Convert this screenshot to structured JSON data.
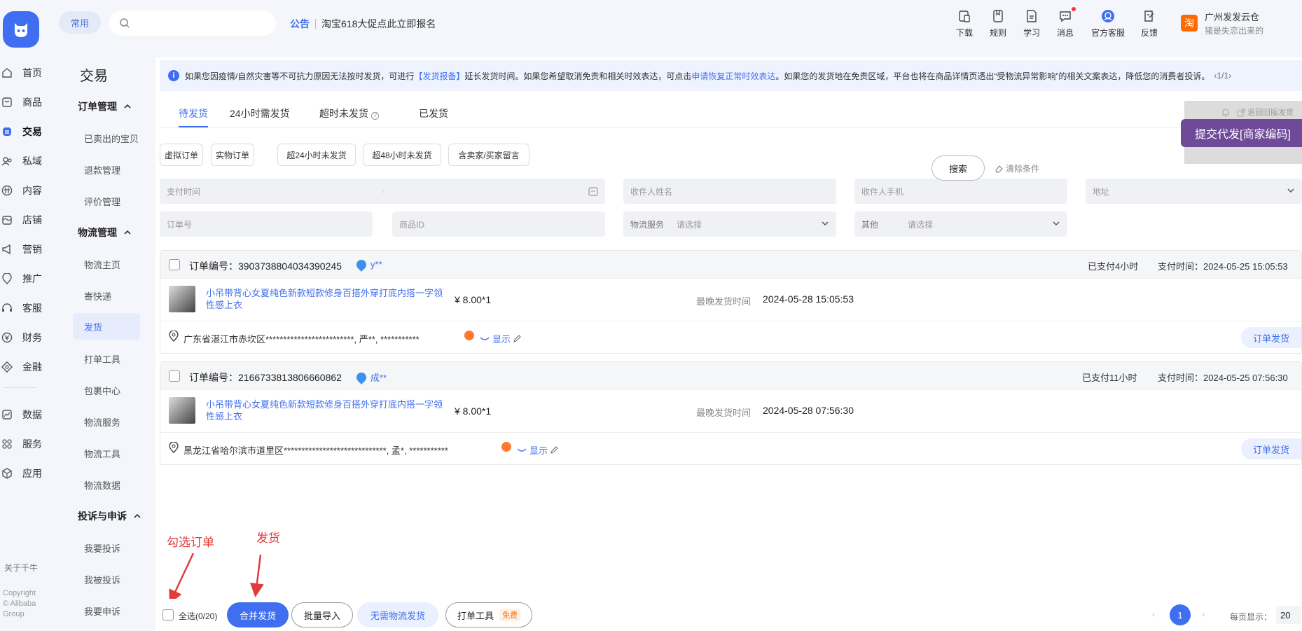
{
  "header": {
    "common_label": "常用",
    "search_placeholder": "",
    "notice_tag": "公告",
    "notice_text": "淘宝618大促点此立即报名",
    "tools": [
      {
        "label": "下载",
        "icon": "download-icon"
      },
      {
        "label": "规则",
        "icon": "rules-icon"
      },
      {
        "label": "学习",
        "icon": "study-icon"
      },
      {
        "label": "消息",
        "icon": "message-icon"
      },
      {
        "label": "官方客服",
        "icon": "service-icon"
      },
      {
        "label": "反馈",
        "icon": "feedback-icon"
      }
    ],
    "shop_badge": "淘",
    "shop_name": "广州发发云仓",
    "shop_sub": "猪是失恋出来的"
  },
  "rail": {
    "items": [
      {
        "label": "首页",
        "icon": "home-icon"
      },
      {
        "label": "商品",
        "icon": "goods-icon"
      },
      {
        "label": "交易",
        "icon": "trade-icon",
        "active": true
      },
      {
        "label": "私域",
        "icon": "private-icon"
      },
      {
        "label": "内容",
        "icon": "content-icon"
      },
      {
        "label": "店铺",
        "icon": "shop-icon"
      },
      {
        "label": "营销",
        "icon": "marketing-icon"
      },
      {
        "label": "推广",
        "icon": "promote-icon"
      },
      {
        "label": "客服",
        "icon": "headset-icon"
      },
      {
        "label": "财务",
        "icon": "finance-icon"
      },
      {
        "label": "金融",
        "icon": "loan-icon"
      },
      {
        "label": "数据",
        "icon": "data-icon"
      },
      {
        "label": "服务",
        "icon": "service-grid-icon"
      },
      {
        "label": "应用",
        "icon": "apps-icon"
      }
    ],
    "about": "关于千牛",
    "copyright": [
      "Copyright",
      "© Alibaba",
      "Group"
    ]
  },
  "subnav": {
    "title": "交易",
    "groups": [
      {
        "label": "订单管理",
        "items": [
          "已卖出的宝贝",
          "退款管理",
          "评价管理"
        ]
      },
      {
        "label": "物流管理",
        "items": [
          "物流主页",
          "寄快递",
          "发货",
          "打单工具",
          "包裹中心",
          "物流服务",
          "物流工具",
          "物流数据"
        ]
      },
      {
        "label": "投诉与申诉",
        "items": [
          "我要投诉",
          "我被投诉",
          "我要申诉"
        ]
      }
    ],
    "active_item": "发货"
  },
  "banner": {
    "text_1": "如果您因疫情/自然灾害等不可抗力原因无法按时发货，可进行",
    "link_1": "【发货报备】",
    "text_2": "延长发货时间。如果您希望取消免责和相关时效表达，可点击",
    "link_2": "申请恢复正常时效表达",
    "text_3": "。如果您的发货地在免责区域，平台也将在商品详情页透出“受物流异常影响”的相关文案表达，降低您的消费者投诉。",
    "pager": "‹1/1›"
  },
  "tabs": [
    {
      "label": "待发货",
      "active": true
    },
    {
      "label": "24小时需发货"
    },
    {
      "label": "超时未发货"
    },
    {
      "label": "已发货"
    }
  ],
  "side_box": {
    "text": "返回旧版发货",
    "submit": "提交代发[商家编码]"
  },
  "filter_chips": [
    "虚拟订单",
    "实物订单",
    "超24小时未发货",
    "超48小时未发货",
    "含卖家/买家留言"
  ],
  "filters": {
    "pay_time": "支付时间",
    "pay_time_sep": "-",
    "receiver_name": "收件人姓名",
    "receiver_phone": "收件人手机",
    "address": "地址",
    "order_no": "订单号",
    "product_id": "商品ID",
    "logistics_label": "物流服务",
    "logistics_value": "请选择",
    "other_label": "其他",
    "other_value": "请选择",
    "search": "搜索",
    "clear": "清除条件"
  },
  "orders": [
    {
      "order_no": "订单编号：3903738804034390245",
      "buyer": "y**",
      "paid": "已支付4小时",
      "pay_time": "支付时间：2024-05-25 15:05:53",
      "title": "小吊带背心女夏纯色新款短款修身百搭外穿打底内搭一字领性感上衣",
      "price": "¥ 8.00*1",
      "latest_label": "最晚发货时间",
      "latest_value": "2024-05-28 15:05:53",
      "address": "广东省湛江市赤坎区*************************, 严**, ***********",
      "show": "显示",
      "ship": "订单发货"
    },
    {
      "order_no": "订单编号：2166733813806660862",
      "buyer": "成**",
      "paid": "已支付11小时",
      "pay_time": "支付时间：2024-05-25 07:56:30",
      "title": "小吊带背心女夏纯色新款短款修身百搭外穿打底内搭一字领性感上衣",
      "price": "¥ 8.00*1",
      "latest_label": "最晚发货时间",
      "latest_value": "2024-05-28 07:56:30",
      "address": "黑龙江省哈尔滨市道里区*****************************, 孟*, ***********",
      "show": "显示",
      "ship": "订单发货"
    }
  ],
  "annotations": {
    "select_orders": "勾选订单",
    "ship": "发货"
  },
  "bottom": {
    "select_all": "全选(0/20)",
    "merge_ship": "合并发货",
    "batch_import": "批量导入",
    "no_logistics": "无需物流发货",
    "print_tool": "打单工具",
    "free": "免费",
    "page": "1",
    "per_page_label": "每页显示：",
    "per_page": "20"
  },
  "colors": {
    "accent": "#3f6ff0",
    "annotation": "#e23b3b",
    "submit": "#6e4a98"
  }
}
